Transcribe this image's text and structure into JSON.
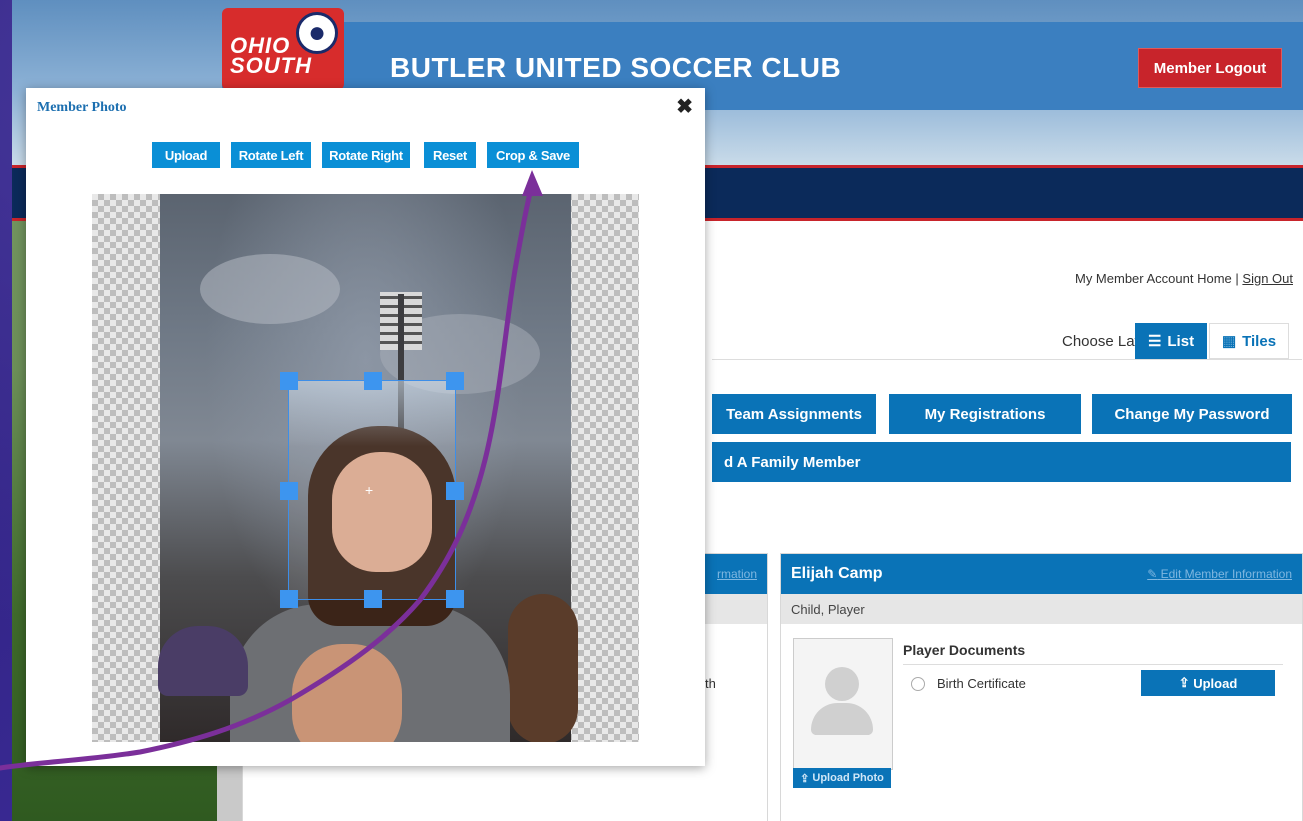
{
  "page": {
    "club_title": "BUTLER UNITED SOCCER CLUB",
    "logo_text": "OHIO SOUTH",
    "logout_label": "Member Logout",
    "account_home_label": "My Member Account Home",
    "separator": "|",
    "signout_label": "Sign Out",
    "layout_label": "Choose Layout:",
    "layout_list_label": "List",
    "layout_tiles_label": "Tiles",
    "actions": [
      {
        "label": "Team Assignments"
      },
      {
        "label": "My Registrations"
      },
      {
        "label": "Change My Password"
      }
    ],
    "family_label": "d A Family Member",
    "card_left": {
      "edit_label": "rmation",
      "doc_fragment": "th"
    },
    "card_right": {
      "name": "Elijah Camp",
      "edit_label": "Edit Member Information",
      "roles": "Child, Player",
      "upload_photo_label": "Upload Photo",
      "docs_title": "Player Documents",
      "doc_name": "Birth Certificate",
      "doc_upload_label": "Upload"
    }
  },
  "modal": {
    "title": "Member Photo",
    "close_symbol": "✖",
    "buttons": [
      {
        "label": "Upload"
      },
      {
        "label": "Rotate Left"
      },
      {
        "label": "Rotate Right"
      },
      {
        "label": "Reset"
      },
      {
        "label": "Crop & Save"
      }
    ]
  },
  "colors": {
    "brand_blue": "#0a73b7",
    "toolbar_blue": "#0a8fd6",
    "logout_red": "#c8242b",
    "annotation_purple": "#7b2f9a",
    "crop_handle": "#3d95ef"
  },
  "icons": [
    "close-icon",
    "list-icon",
    "tiles-icon",
    "edit-pencil-icon",
    "upload-icon",
    "user-silhouette-icon",
    "radio-icon",
    "crosshair-icon"
  ]
}
